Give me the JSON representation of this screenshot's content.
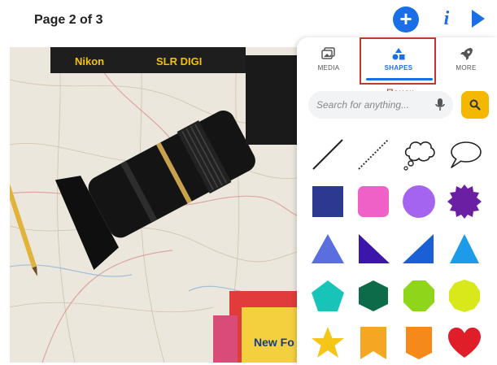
{
  "header": {
    "page_indicator": "Page 2 of 3",
    "add_label": "+",
    "info_label": "i"
  },
  "panel": {
    "tabs": [
      {
        "label": "MEDIA",
        "icon": "images-icon"
      },
      {
        "label": "SHAPES",
        "icon": "shapes-icon",
        "active": true
      },
      {
        "label": "MORE",
        "icon": "rocket-icon"
      }
    ],
    "annotation": "Поиск",
    "search": {
      "placeholder": "Search for anything..."
    },
    "shapes": [
      {
        "name": "line",
        "color": "#222222"
      },
      {
        "name": "dotted-line",
        "color": "#333333"
      },
      {
        "name": "thought-bubble",
        "color": "#222222"
      },
      {
        "name": "speech-bubble",
        "color": "#222222"
      },
      {
        "name": "square",
        "color": "#2b3990"
      },
      {
        "name": "rounded-square",
        "color": "#f061c8"
      },
      {
        "name": "circle",
        "color": "#a564f0"
      },
      {
        "name": "badge",
        "color": "#6b1fa3"
      },
      {
        "name": "triangle",
        "color": "#5a6ee0"
      },
      {
        "name": "right-triangle-left",
        "color": "#3b16a8"
      },
      {
        "name": "right-triangle-right",
        "color": "#1a5fd6"
      },
      {
        "name": "triangle-blue",
        "color": "#1e9be8"
      },
      {
        "name": "pentagon",
        "color": "#18c4b8"
      },
      {
        "name": "hexagon",
        "color": "#0d6b4a"
      },
      {
        "name": "octagon",
        "color": "#8fd61a"
      },
      {
        "name": "decagon",
        "color": "#d9e81a"
      },
      {
        "name": "star",
        "color": "#f5c518"
      },
      {
        "name": "bookmark",
        "color": "#f5a623"
      },
      {
        "name": "pennant",
        "color": "#f58a1a"
      },
      {
        "name": "heart",
        "color": "#e01e2a"
      }
    ]
  },
  "colors": {
    "accent": "#1a6ee6",
    "search_button": "#f5b800",
    "highlight": "#c0392b"
  }
}
